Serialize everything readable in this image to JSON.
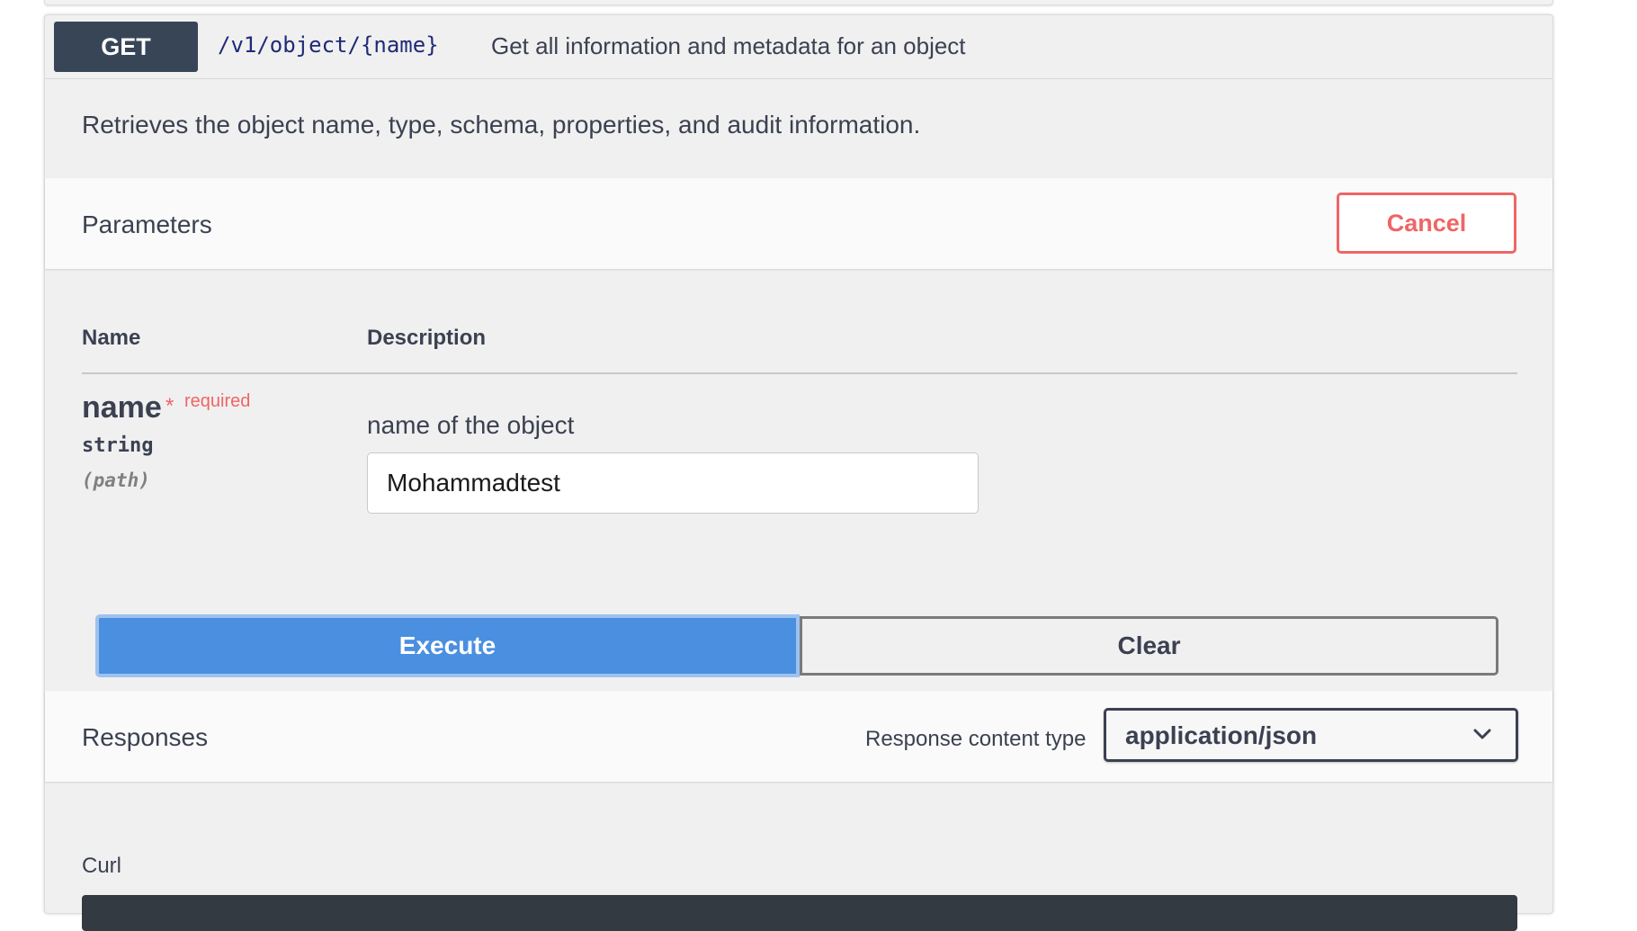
{
  "operation": {
    "method": "GET",
    "path": "/v1/object/{name}",
    "summary": "Get all information and metadata for an object",
    "description": "Retrieves the object name, type, schema, properties, and audit information."
  },
  "parameters": {
    "title": "Parameters",
    "cancel_label": "Cancel",
    "columns": {
      "name": "Name",
      "description": "Description"
    },
    "items": [
      {
        "name": "name",
        "required_star": "*",
        "required_label": "required",
        "type": "string",
        "in": "(path)",
        "description": "name of the object",
        "value": "Mohammadtest"
      }
    ]
  },
  "actions": {
    "execute_label": "Execute",
    "clear_label": "Clear"
  },
  "responses": {
    "title": "Responses",
    "content_type_label": "Response content type",
    "content_type_value": "application/json",
    "curl_label": "Curl"
  },
  "colors": {
    "method_bg": "#374557",
    "cancel": "#f06565",
    "execute": "#4a8fe0",
    "required": "#f06565"
  },
  "icons": {
    "select": "chevron-down-icon"
  }
}
